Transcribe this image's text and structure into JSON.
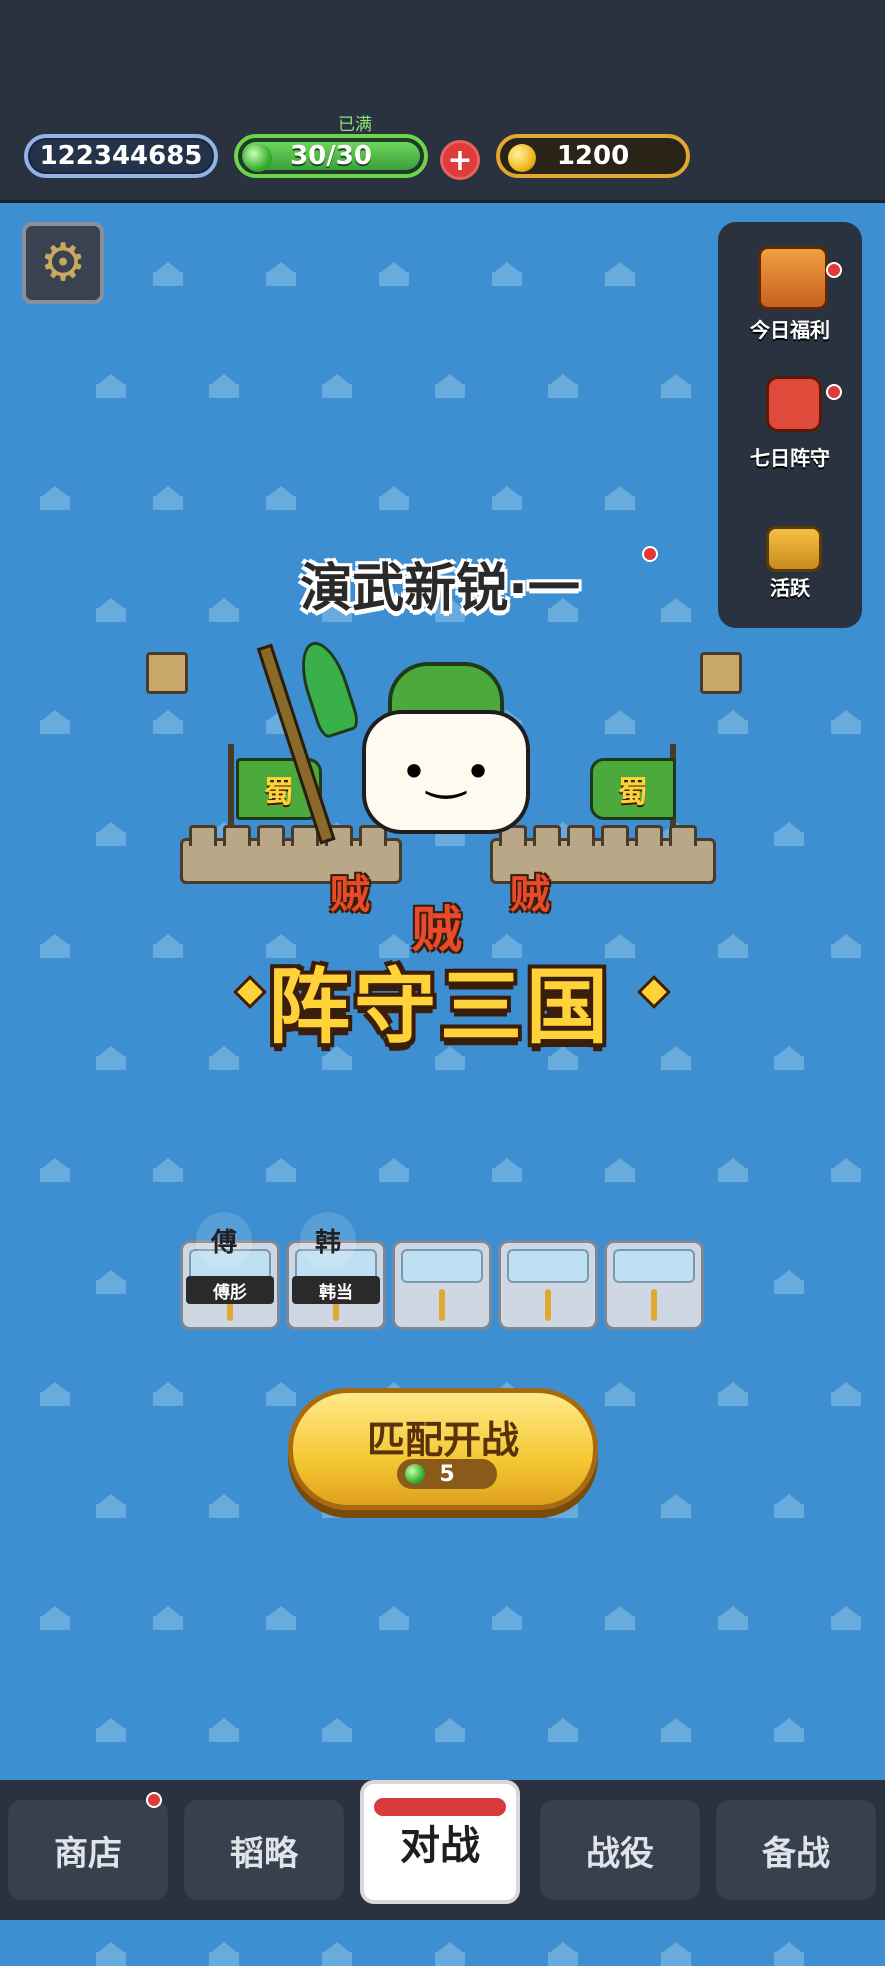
{
  "header": {
    "player_id": "122344685",
    "energy_status": "已满",
    "energy": "30/30",
    "plus_label": "+",
    "coins": "1200"
  },
  "side_menu": {
    "items": [
      {
        "label": "今日福利",
        "icon": "treasure-chest-icon"
      },
      {
        "label": "七日阵守",
        "icon": "gift-icon"
      },
      {
        "label": "活跃",
        "icon": "chest-icon"
      }
    ]
  },
  "banner": {
    "subtitle": "演武新锐·一",
    "title": "阵守三国",
    "flag_text": "蜀",
    "enemy_text": "贼"
  },
  "lineup": {
    "units": [
      {
        "badge": "傅",
        "name": "傅肜"
      },
      {
        "badge": "韩",
        "name": "韩当"
      }
    ]
  },
  "start_button": {
    "label": "匹配开战",
    "cost": "5"
  },
  "nav": {
    "tabs": [
      {
        "label": "商店"
      },
      {
        "label": "韬略"
      },
      {
        "label": "对战"
      },
      {
        "label": "战役"
      },
      {
        "label": "备战"
      }
    ],
    "active": "对战"
  },
  "colors": {
    "background": "#3d8fd1",
    "bar": "#2a3240",
    "accent_gold": "#ffd23a",
    "energy_green": "#4caa3c",
    "alert_red": "#e03a3a"
  }
}
